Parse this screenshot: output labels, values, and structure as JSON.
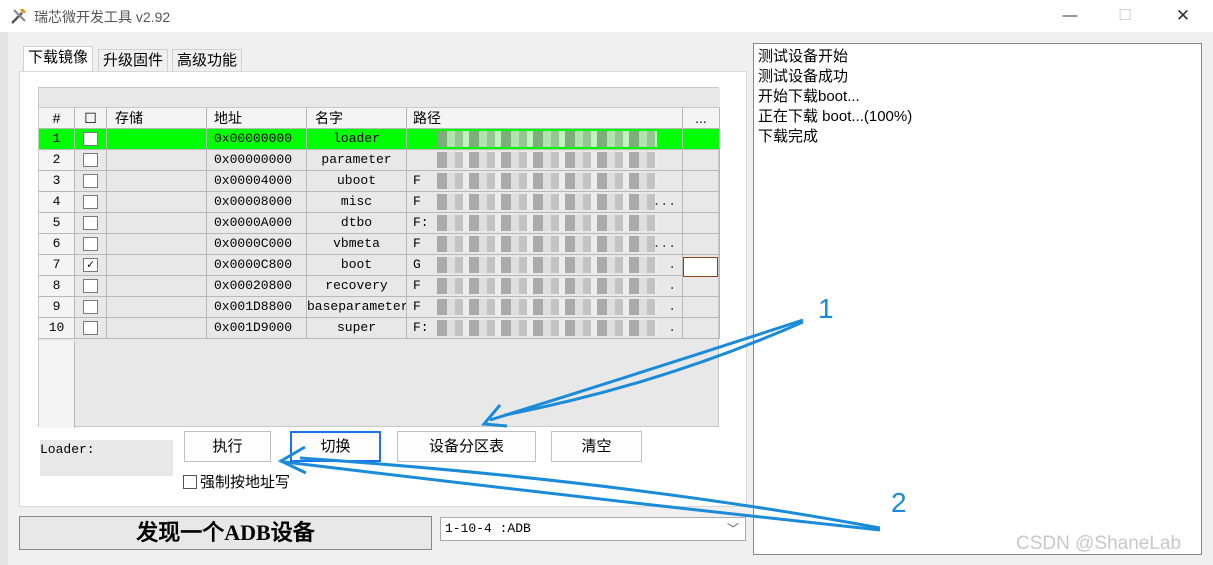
{
  "window": {
    "title": "瑞芯微开发工具 v2.92",
    "app_icon": "tools-icon",
    "minimize": "—",
    "maximize": "☐",
    "close": "✕"
  },
  "tabs": [
    {
      "label": "下载镜像",
      "active": true
    },
    {
      "label": "升级固件",
      "active": false
    },
    {
      "label": "高级功能",
      "active": false
    }
  ],
  "table": {
    "headers": {
      "num": "#",
      "check": "☐",
      "storage": "存储",
      "address": "地址",
      "name": "名字",
      "path": "路径",
      "more": "..."
    },
    "rows": [
      {
        "num": "1",
        "checked": false,
        "address": "0x00000000",
        "name": "loader",
        "path_first": "",
        "path_tail": "",
        "selected": true
      },
      {
        "num": "2",
        "checked": false,
        "address": "0x00000000",
        "name": "parameter",
        "path_first": "",
        "path_tail": ""
      },
      {
        "num": "3",
        "checked": false,
        "address": "0x00004000",
        "name": "uboot",
        "path_first": "F",
        "path_tail": ""
      },
      {
        "num": "4",
        "checked": false,
        "address": "0x00008000",
        "name": "misc",
        "path_first": "F",
        "path_tail": "..."
      },
      {
        "num": "5",
        "checked": false,
        "address": "0x0000A000",
        "name": "dtbo",
        "path_first": "F:",
        "path_tail": ""
      },
      {
        "num": "6",
        "checked": false,
        "address": "0x0000C000",
        "name": "vbmeta",
        "path_first": "F",
        "path_tail": "..."
      },
      {
        "num": "7",
        "checked": true,
        "address": "0x0000C800",
        "name": "boot",
        "path_first": "G",
        "path_tail": "."
      },
      {
        "num": "8",
        "checked": false,
        "address": "0x00020800",
        "name": "recovery",
        "path_first": "F",
        "path_tail": "."
      },
      {
        "num": "9",
        "checked": false,
        "address": "0x001D8800",
        "name": "baseparameter",
        "path_first": "F",
        "path_tail": "."
      },
      {
        "num": "10",
        "checked": false,
        "address": "0x001D9000",
        "name": "super",
        "path_first": "F:",
        "path_tail": "."
      }
    ]
  },
  "loader_label": "Loader:",
  "buttons": {
    "execute": "执行",
    "switch": "切换",
    "partition_table": "设备分区表",
    "clear": "清空"
  },
  "force_address_write": "强制按地址写",
  "status": "发现一个ADB设备",
  "device_select": "1-10-4 :ADB",
  "log": [
    "测试设备开始",
    "测试设备成功",
    "开始下载boot...",
    "正在下载 boot...(100%)",
    "下载完成"
  ],
  "annotations": {
    "one": "1",
    "two": "2"
  },
  "watermark": "CSDN @ShaneLab",
  "colors": {
    "selected_row": "#00ff00",
    "annotation": "#1a8bd8"
  }
}
